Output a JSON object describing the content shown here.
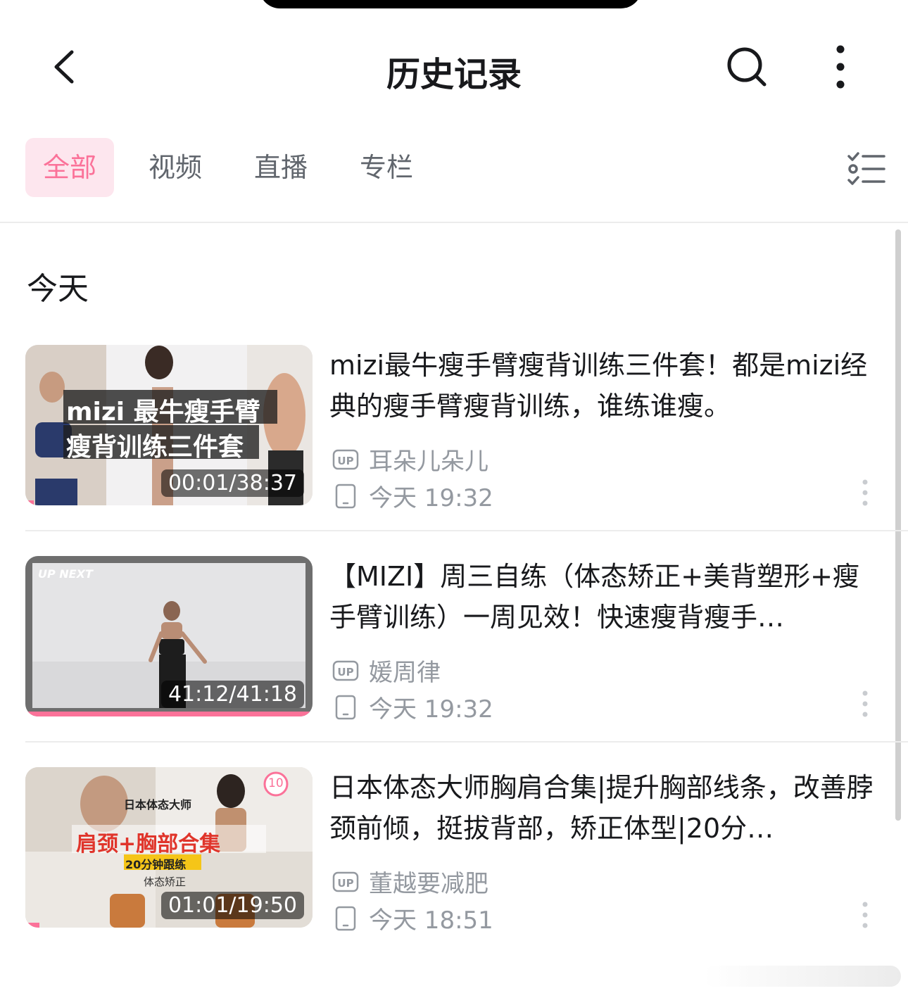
{
  "header": {
    "title": "历史记录",
    "back_icon": "chevron-left-icon",
    "search_icon": "search-icon",
    "more_icon": "more-vertical-icon"
  },
  "tabs": [
    {
      "label": "全部",
      "active": true
    },
    {
      "label": "视频",
      "active": false
    },
    {
      "label": "直播",
      "active": false
    },
    {
      "label": "专栏",
      "active": false
    }
  ],
  "filter_icon": "checklist-icon",
  "section": {
    "title": "今天"
  },
  "colors": {
    "accent": "#fb7299",
    "accent_bg": "#fde6ee",
    "text": "#18191c",
    "muted": "#9499a0"
  },
  "items": [
    {
      "title": "mizi最牛瘦手臂瘦背训练三件套！都是mizi经典的瘦手臂瘦背训练，谁练谁瘦。",
      "duration": "00:01/38:37",
      "thumb_text": [
        "mizi 最牛瘦手臂",
        "瘦背训练三件套"
      ],
      "uploader": "耳朵儿朵儿",
      "watched": "今天 19:32",
      "device": "tablet-icon",
      "progress": 0.03
    },
    {
      "title": "【MIZI】周三自练（体态矫正+美背塑形+瘦手臂训练）一周见效！快速瘦背瘦手…",
      "duration": "41:12/41:18",
      "thumb_text": [
        "UP NEXT"
      ],
      "uploader": "媛周律",
      "watched": "今天 19:32",
      "device": "tablet-icon",
      "progress": 1.0
    },
    {
      "title": "日本体态大师胸肩合集|提升胸部线条，改善脖颈前倾，挺拔背部，矫正体型|20分…",
      "duration": "01:01/19:50",
      "thumb_text": [
        "日本体态大师",
        "肩颈+胸部合集",
        "20分钟跟练",
        "体态矫正",
        "10"
      ],
      "uploader": "董越要减肥",
      "watched": "今天 18:51",
      "device": "tablet-icon",
      "progress": 0.05
    }
  ]
}
